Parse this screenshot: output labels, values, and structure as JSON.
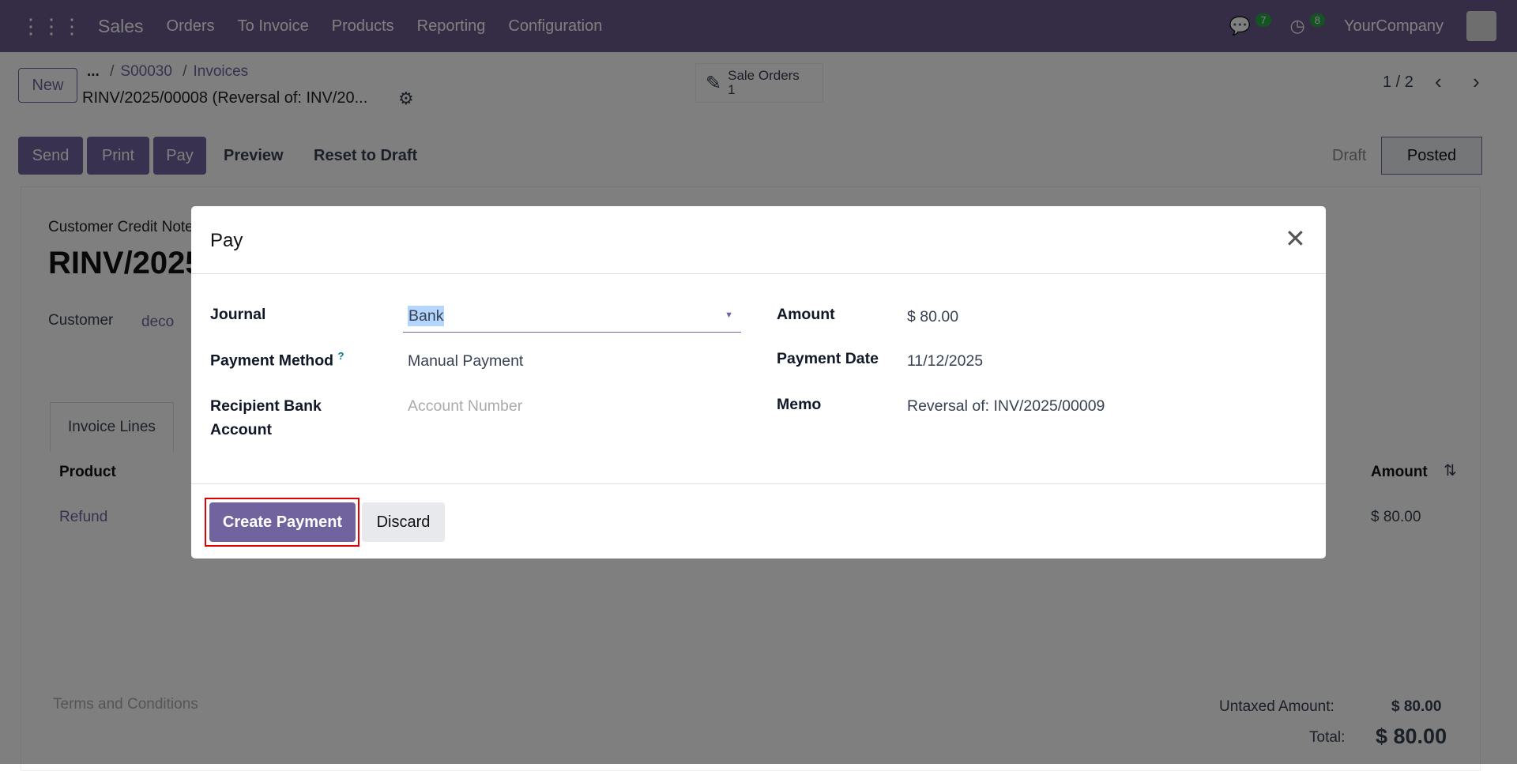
{
  "navbar": {
    "app": "Sales",
    "menu": [
      "Orders",
      "To Invoice",
      "Products",
      "Reporting",
      "Configuration"
    ],
    "messages_count": "7",
    "activities_count": "8",
    "company": "YourCompany"
  },
  "breadcrumb": {
    "new_label": "New",
    "ellipsis": "...",
    "items": [
      "S00030",
      "Invoices"
    ],
    "record": "RINV/2025/00008 (Reversal of: INV/20..."
  },
  "smart_button": {
    "label": "Sale Orders",
    "count": "1"
  },
  "pager": {
    "value": "1 / 2"
  },
  "actions": {
    "send": "Send",
    "print": "Print",
    "pay": "Pay",
    "preview": "Preview",
    "reset": "Reset to Draft"
  },
  "status": {
    "draft": "Draft",
    "posted": "Posted"
  },
  "form": {
    "type": "Customer Credit Note",
    "name": "RINV/2025",
    "customer_label": "Customer",
    "customer": "deco",
    "tab": "Invoice Lines",
    "col_product": "Product",
    "col_amount": "Amount",
    "line_product": "Refund",
    "line_amount": "$ 80.00",
    "terms_placeholder": "Terms and Conditions",
    "untaxed_label": "Untaxed Amount:",
    "untaxed": "$ 80.00",
    "total_label": "Total:",
    "total": "$ 80.00"
  },
  "dialog": {
    "title": "Pay",
    "journal_label": "Journal",
    "journal": "Bank",
    "payment_method_label": "Payment Method",
    "help": "?",
    "payment_method": "Manual Payment",
    "recipient_label": "Recipient Bank Account",
    "recipient_placeholder": "Account Number",
    "amount_label": "Amount",
    "amount": "$ 80.00",
    "date_label": "Payment Date",
    "date": "11/12/2025",
    "memo_label": "Memo",
    "memo": "Reversal of: INV/2025/00009",
    "create": "Create Payment",
    "discard": "Discard"
  },
  "colors": {
    "brand": "#71639e",
    "highlight": "#e00000"
  }
}
